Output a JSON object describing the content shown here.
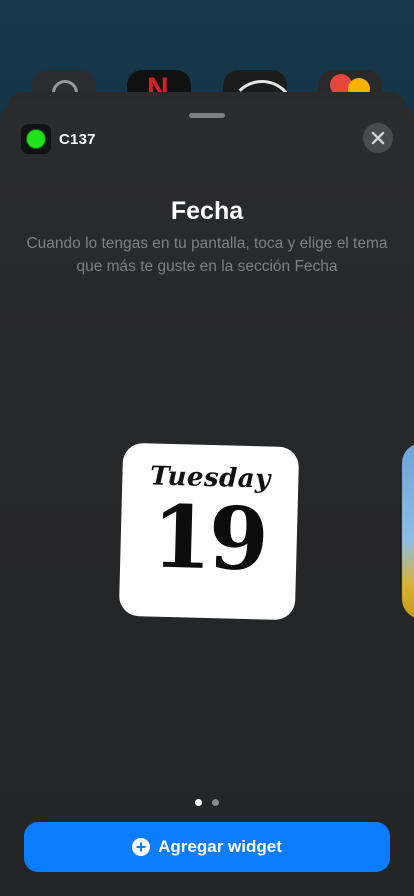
{
  "app": {
    "name": "C137",
    "icon": "green-dot-icon",
    "accent": "#21e21a"
  },
  "sheet": {
    "title": "Fecha",
    "description": "Cuando lo tengas en tu pantalla, toca y elige el tema que más te guste en la sección Fecha",
    "close_icon": "close-icon"
  },
  "widget": {
    "day": "Tuesday",
    "date": "19"
  },
  "pager": {
    "count": 2,
    "active": 1
  },
  "add_button": {
    "label": "Agregar widget",
    "icon": "plus-circle-icon",
    "color": "#0a7cff"
  }
}
